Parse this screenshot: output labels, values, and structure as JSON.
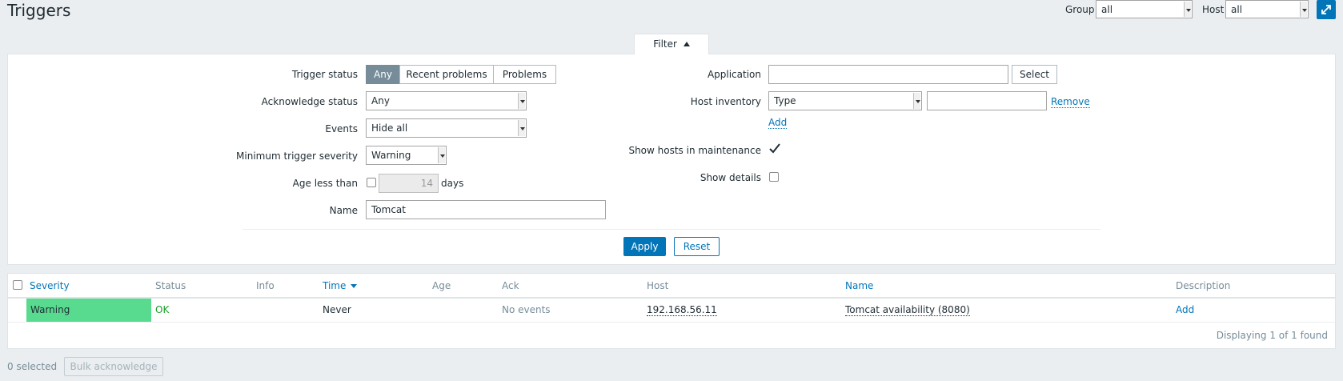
{
  "page": {
    "title": "Triggers",
    "group_label": "Group",
    "group_value": "all",
    "host_label": "Host",
    "host_value": "all"
  },
  "filter": {
    "tab_label": "Filter",
    "trigger_status": {
      "label": "Trigger status",
      "options": [
        "Any",
        "Recent problems",
        "Problems"
      ],
      "selected": "Any"
    },
    "acknowledge_status": {
      "label": "Acknowledge status",
      "value": "Any"
    },
    "events": {
      "label": "Events",
      "value": "Hide all"
    },
    "min_severity": {
      "label": "Minimum trigger severity",
      "value": "Warning"
    },
    "age": {
      "label": "Age less than",
      "value": "14",
      "unit": "days",
      "checked": false
    },
    "name": {
      "label": "Name",
      "value": "Tomcat"
    },
    "application": {
      "label": "Application",
      "value": "",
      "select_label": "Select"
    },
    "host_inventory": {
      "label": "Host inventory",
      "field": "Type",
      "value": "",
      "remove_label": "Remove",
      "add_label": "Add"
    },
    "show_maintenance": {
      "label": "Show hosts in maintenance",
      "checked": true
    },
    "show_details": {
      "label": "Show details",
      "checked": false
    },
    "apply_label": "Apply",
    "reset_label": "Reset"
  },
  "table": {
    "columns": [
      "Severity",
      "Status",
      "Info",
      "Time",
      "Age",
      "Ack",
      "Host",
      "Name",
      "Description"
    ],
    "rows": [
      {
        "severity": "Warning",
        "status": "OK",
        "info": "",
        "time": "Never",
        "age": "",
        "ack": "No events",
        "host": "192.168.56.11",
        "name": "Tomcat availability (8080)",
        "description": "Add"
      }
    ],
    "footer": "Displaying 1 of 1 found"
  },
  "bottom": {
    "selected": "0 selected",
    "bulk_ack_label": "Bulk acknowledge"
  },
  "colors": {
    "warning_bg": "#59db8f",
    "ok_text": "#1a9d29",
    "link": "#0275b8",
    "apply_bg": "#0275b8",
    "active_segment": "#768d99"
  }
}
